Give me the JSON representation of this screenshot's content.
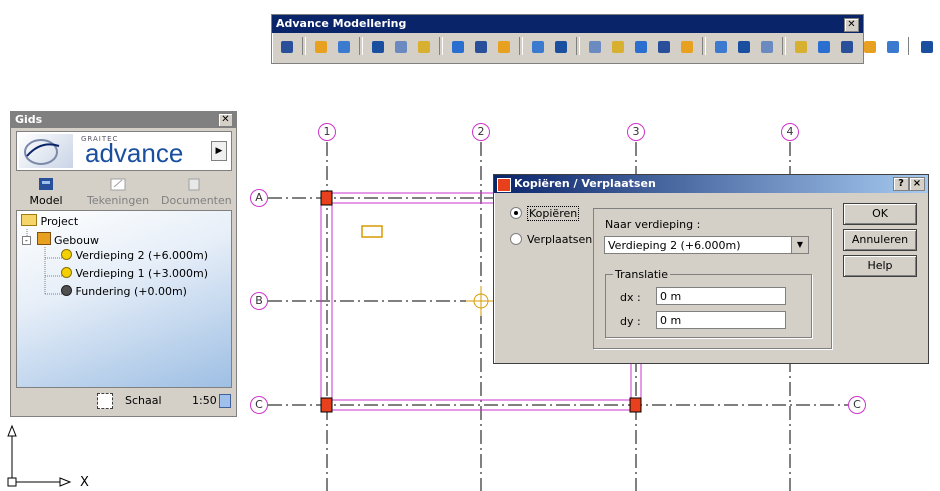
{
  "toolbar": {
    "title": "Advance Modellering",
    "icons": [
      "guide-icon",
      "folder-icon",
      "layers-icon",
      "grid-icon",
      "column-icon",
      "beam-icon",
      "slab-icon",
      "wall-icon",
      "roof-icon",
      "stair-icon",
      "element-icon",
      "opening-icon",
      "hatch-icon",
      "measure-icon",
      "axis-icon",
      "wave-icon",
      "split-icon",
      "pen-icon",
      "brush-icon",
      "copy-icon",
      "paste-icon",
      "move-icon",
      "rotate-icon",
      "house-icon",
      "view-icon",
      "check-icon"
    ]
  },
  "gids": {
    "title": "Gids",
    "brand_company": "GRAITEC",
    "brand_name": "advance",
    "tabs": [
      {
        "label": "Model"
      },
      {
        "label": "Tekeningen"
      },
      {
        "label": "Documenten"
      }
    ],
    "tree": {
      "project": "Project",
      "building": "Gebouw",
      "levels": [
        {
          "label": "Verdieping 2 (+6.000m)"
        },
        {
          "label": "Verdieping 1 (+3.000m)"
        },
        {
          "label": "Fundering (+0.00m)"
        }
      ]
    },
    "status": {
      "scale_label": "Schaal",
      "scale_value": "1:50"
    }
  },
  "canvas": {
    "grid_columns": [
      "1",
      "2",
      "3",
      "4"
    ],
    "grid_rows": [
      "A",
      "B",
      "C"
    ],
    "ucs": {
      "y": "Y",
      "x": "X"
    }
  },
  "dialog": {
    "title": "Kopiëren / Verplaatsen",
    "help_btn": "?",
    "close_btn": "×",
    "radio_copy": "Kopiëren",
    "radio_move": "Verplaatsen",
    "target_label": "Naar verdieping :",
    "target_value": "Verdieping 2 (+6.000m)",
    "translation_label": "Translatie",
    "dx_label": "dx :",
    "dx_value": "0 m",
    "dy_label": "dy :",
    "dy_value": "0 m",
    "ok": "OK",
    "cancel": "Annuleren",
    "help": "Help"
  },
  "colors": {
    "accent": "#0a246a",
    "grid": "#cc33cc",
    "column": "#e8401c"
  }
}
